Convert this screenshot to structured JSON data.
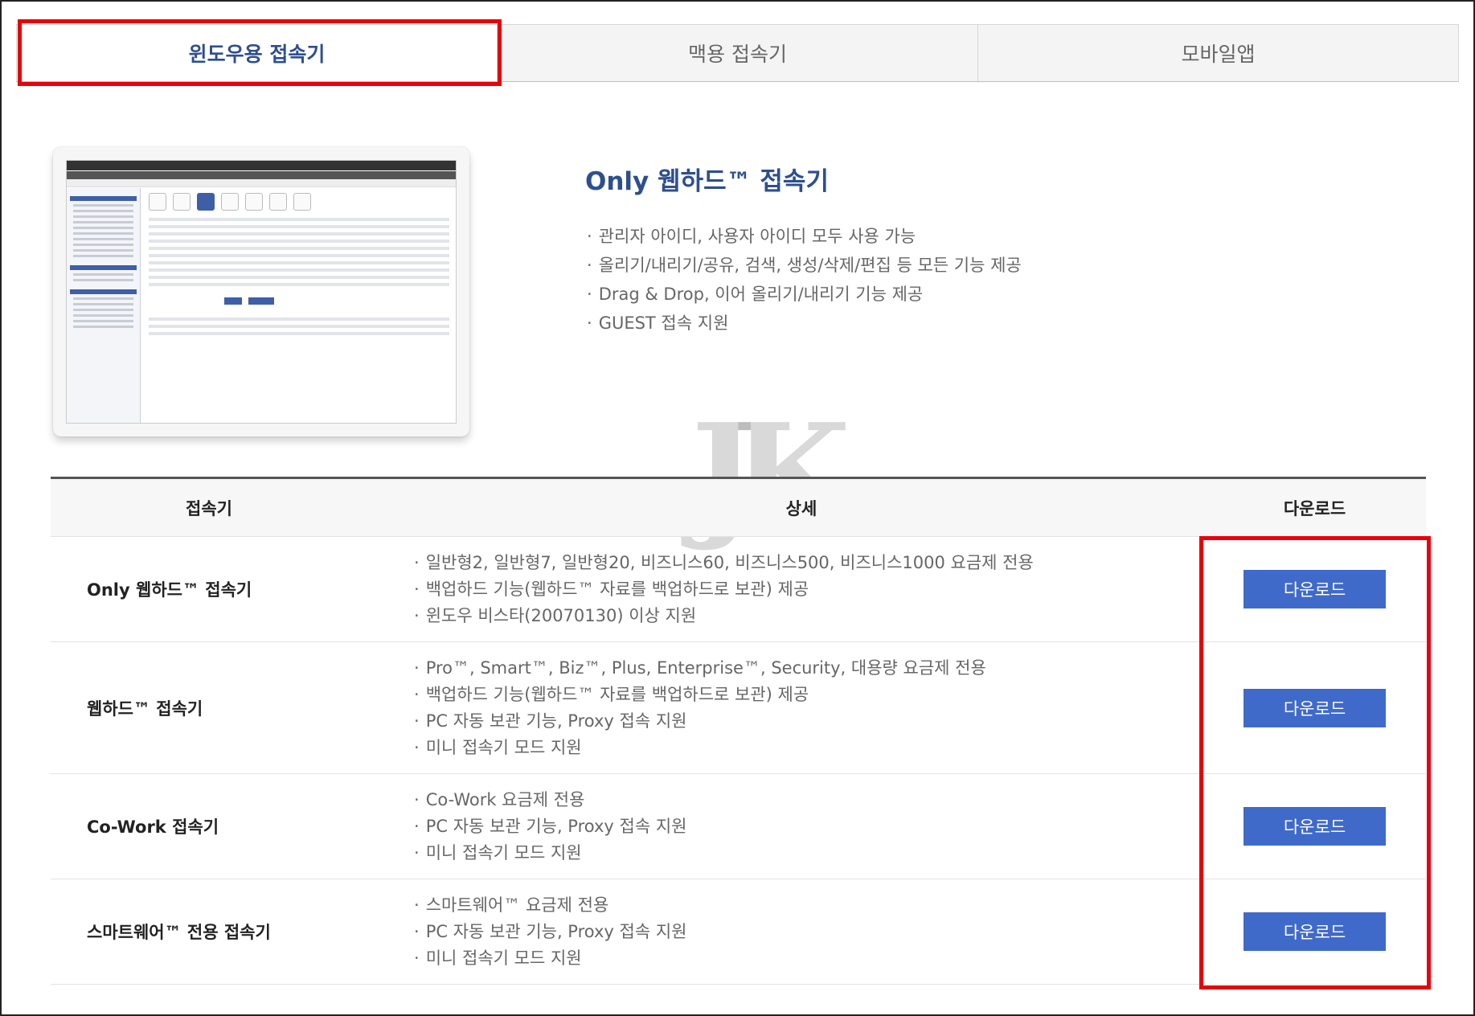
{
  "tabs": [
    {
      "label": "윈도우용 접속기",
      "active": true
    },
    {
      "label": "맥용 접속기",
      "active": false
    },
    {
      "label": "모바일앱",
      "active": false
    }
  ],
  "intro": {
    "title": "Only 웹하드™ 접속기",
    "features": [
      "관리자 아이디, 사용자 아이디 모두 사용 가능",
      "올리기/내리기/공유, 검색, 생성/삭제/편집 등 모든 기능 제공",
      "Drag & Drop, 이어 올리기/내리기 기능 제공",
      "GUEST 접속 지원"
    ]
  },
  "table": {
    "headers": {
      "name": "접속기",
      "detail": "상세",
      "download": "다운로드"
    },
    "rows": [
      {
        "name": "Only 웹하드™ 접속기",
        "details": [
          "일반형2, 일반형7, 일반형20, 비즈니스60, 비즈니스500, 비즈니스1000 요금제 전용",
          "백업하드 기능(웹하드™ 자료를 백업하드로 보관) 제공",
          "윈도우 비스타(20070130) 이상 지원"
        ],
        "button": "다운로드"
      },
      {
        "name": "웹하드™ 접속기",
        "details": [
          "Pro™, Smart™, Biz™, Plus, Enterprise™, Security, 대용량 요금제 전용",
          "백업하드 기능(웹하드™ 자료를 백업하드로 보관) 제공",
          "PC 자동 보관 기능, Proxy 접속 지원",
          "미니 접속기 모드 지원"
        ],
        "button": "다운로드"
      },
      {
        "name": "Co-Work 접속기",
        "details": [
          "Co-Work 요금제 전용",
          "PC 자동 보관 기능, Proxy 접속 지원",
          "미니 접속기 모드 지원"
        ],
        "button": "다운로드"
      },
      {
        "name": "스마트웨어™ 전용 접속기",
        "details": [
          "스마트웨어™ 요금제 전용",
          "PC 자동 보관 기능, Proxy 접속 지원",
          "미니 접속기 모드 지원"
        ],
        "button": "다운로드"
      }
    ]
  },
  "watermark": "JK",
  "colors": {
    "accent": "#2d4f8e",
    "button": "#3f6ac9",
    "highlight": "#e8000b"
  }
}
